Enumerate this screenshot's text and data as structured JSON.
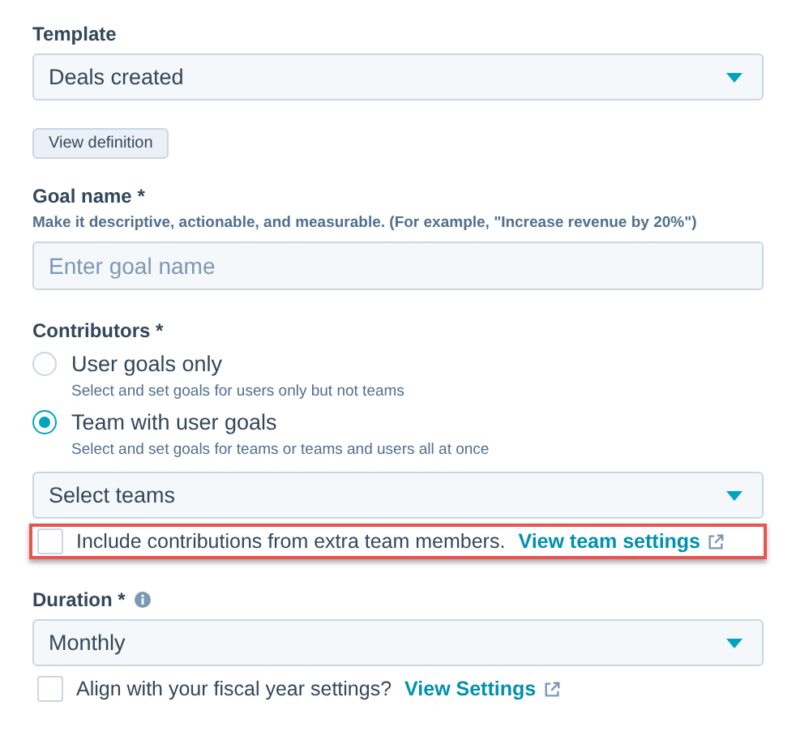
{
  "template": {
    "label": "Template",
    "value": "Deals created",
    "button": "View definition"
  },
  "goal_name": {
    "label": "Goal name *",
    "hint": "Make it descriptive, actionable, and measurable. (For example, \"Increase revenue by 20%\")",
    "placeholder": "Enter goal name"
  },
  "contributors": {
    "label": "Contributors *",
    "options": [
      {
        "label": "User goals only",
        "hint": "Select and set goals for users only but not teams",
        "selected": false
      },
      {
        "label": "Team with user goals",
        "hint": "Select and set goals for teams or teams and users all at once",
        "selected": true
      }
    ],
    "select": "Select teams",
    "checkbox": {
      "label": "Include contributions from extra team members.",
      "link": "View team settings",
      "checked": false,
      "highlighted": true
    }
  },
  "duration": {
    "label": "Duration *",
    "value": "Monthly",
    "checkbox": {
      "label": "Align with your fiscal year settings?",
      "link": "View Settings",
      "checked": false,
      "highlighted": false
    }
  }
}
